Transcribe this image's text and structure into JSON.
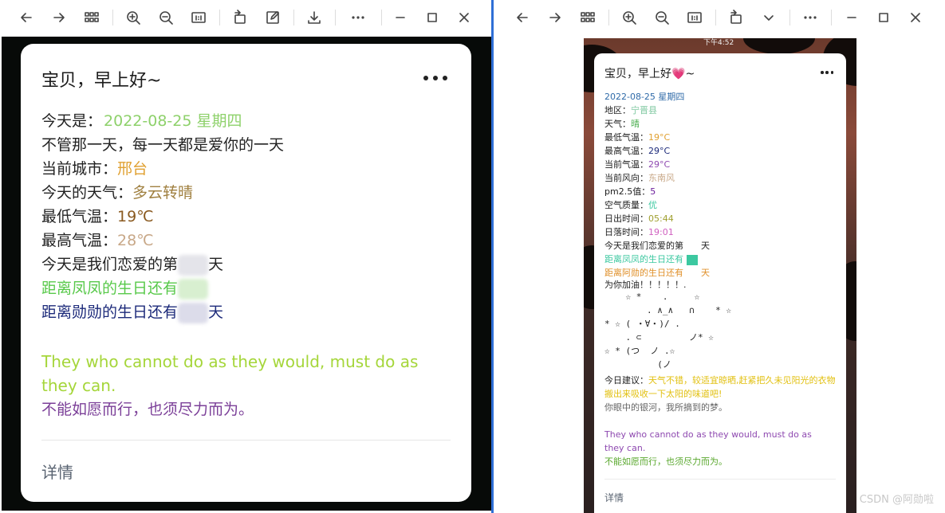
{
  "colors": {
    "toolbar_icon": "#444444",
    "left_bg": "#070a08",
    "card": "#ffffff",
    "green": "#8ed16b",
    "orange": "#e0a030",
    "brown": "#a08040",
    "dark_brown": "#8a5a20",
    "tan": "#c8a888",
    "light_green": "#58c94a",
    "navy": "#1c2a7a",
    "lime": "#a5d63a",
    "purple": "#7b3f98"
  },
  "left": {
    "toolbar_icons": [
      "back-arrow-icon",
      "forward-arrow-icon",
      "grid-view-icon",
      "zoom-in-icon",
      "zoom-out-icon",
      "actual-size-icon",
      "rotate-icon",
      "edit-icon",
      "download-icon",
      "more-horizontal-icon",
      "minimize-icon",
      "maximize-icon",
      "close-icon"
    ],
    "title": "宝贝，早上好~",
    "lines": {
      "date_label": "今天是：",
      "date_value": "2022-08-25 星期四",
      "love_text": "不管那一天，每一天都是爱你的一天",
      "city_label": "当前城市：",
      "city_value": "邢台",
      "weather_label": "今天的天气：",
      "weather_value": "多云转晴",
      "low_label": "最低气温：",
      "low_value": "19℃",
      "high_label": "最高气温：",
      "high_value": "28℃",
      "love_days_prefix": "今天是我们恋爱的第",
      "love_days_suffix": "天",
      "bday1_text": "距离凤凤的生日还有",
      "bday2_text": "距离勋勋的生日还有",
      "bday2_suffix": "天"
    },
    "quote_en": "They who cannot do as they would, must do as they can.",
    "quote_cn": "不能如愿而行，也须尽力而为。",
    "detail": "详情"
  },
  "right": {
    "toolbar_icons": [
      "back-arrow-icon",
      "forward-arrow-icon",
      "grid-view-icon",
      "zoom-in-icon",
      "zoom-out-icon",
      "actual-size-icon",
      "rotate-icon",
      "chevron-down-icon",
      "more-horizontal-icon",
      "minimize-icon",
      "maximize-icon",
      "close-icon"
    ],
    "status_time": "下午4:52",
    "title": "宝贝，早上好",
    "title_heart": "💗",
    "title_tail": "~",
    "date": "2022-08-25 星期四",
    "region_label": "地区：",
    "region_value": "宁晋县",
    "weather_label": "天气：",
    "weather_value": "晴",
    "low_label": "最低气温：",
    "low_value": "19°C",
    "high_label": "最高气温：",
    "high_value": "29°C",
    "cur_label": "当前气温：",
    "cur_value": "29°C",
    "wind_label": "当前风向：",
    "wind_value": "东南风",
    "pm_label": "pm2.5值：",
    "pm_value": "5",
    "air_label": "空气质量：",
    "air_value": "优",
    "sunrise_label": "日出时间：",
    "sunrise_value": "05:44",
    "sunset_label": "日落时间：",
    "sunset_value": "19:01",
    "love_prefix": "今天是我们恋爱的第",
    "love_suffix": "天",
    "bday1_text": "距离凤凤的生日还有",
    "bday2_text": "距离阿勋的生日还有",
    "bday2_suffix": "天",
    "cheer": "为你加油！！！！！.",
    "kaomoji": "    ☆ *    .     ☆\n        . ∧_∧   ∩    * ☆\n* ☆ ( ・∀・)/ .\n    . ⊂         ノ* ☆\n☆ * (つ  ノ .☆\n          (ノ",
    "advice_label": "今日建议：",
    "advice_value": "天气不错，较适宜晾晒,赶紧把久未见阳光的衣物搬出来吸收一下太阳的味道吧!",
    "galaxy": "你眼中的银河，我所摘到的梦。",
    "quote_en": "They who cannot do as they would, must do as they can.",
    "quote_cn": "不能如愿而行，也须尽力而为。",
    "detail": "详情",
    "text_colors": {
      "date": "#2e6aa8",
      "region": "#7ec8a0",
      "weather": "#4caf50",
      "low": "#e0a030",
      "high": "#1c2a7a",
      "cur": "#8e49b0",
      "wind": "#c8a888",
      "pm": "#6a1b9a",
      "air": "#3cc8a0",
      "sunrise": "#a0a030",
      "sunset": "#d060c0",
      "bday1": "#3cc8a0",
      "bday2": "#e0902a"
    }
  },
  "watermark": "CSDN @阿勋啦"
}
